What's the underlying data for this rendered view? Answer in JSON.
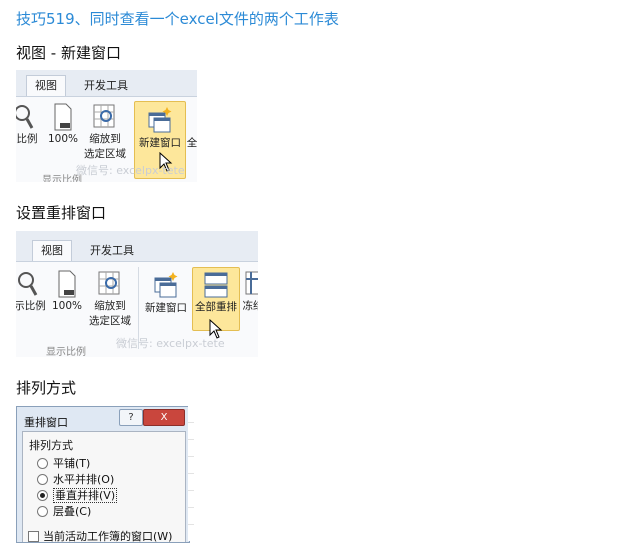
{
  "title": "技巧519、同时查看一个excel文件的两个工作表",
  "sections": {
    "s1": "视图 - 新建窗口",
    "s2": "设置重排窗口",
    "s3": "排列方式"
  },
  "ribbon1": {
    "tabs": [
      "视图",
      "开发工具"
    ],
    "buttons": {
      "zoom": "比例",
      "zoom100": "100%",
      "zoom_sel_1": "缩放到",
      "zoom_sel_2": "选定区域",
      "new_window": "新建窗口",
      "arrange_partial": "全"
    },
    "group_label": "显示比例",
    "watermark": "微信号: excelpx-tete"
  },
  "ribbon2": {
    "tabs": [
      "视图",
      "开发工具"
    ],
    "buttons": {
      "zoom": "示比例",
      "zoom100": "100%",
      "zoom_sel_1": "缩放到",
      "zoom_sel_2": "选定区域",
      "new_window": "新建窗口",
      "arrange_all": "全部重排",
      "freeze_partial": "冻结"
    },
    "group_label": "显示比例",
    "watermark": "微信号: excelpx-tete"
  },
  "dialog": {
    "title": "重排窗口",
    "help": "?",
    "close": "X",
    "fieldset": "排列方式",
    "options": [
      {
        "label": "平铺(T)",
        "selected": false
      },
      {
        "label": "水平并排(O)",
        "selected": false
      },
      {
        "label": "垂直并排(V)",
        "selected": true
      },
      {
        "label": "层叠(C)",
        "selected": false
      }
    ],
    "checkbox": "当前活动工作簿的窗口(W)"
  },
  "colors": {
    "title": "#2b8ad6",
    "highlight": "#fde79b",
    "close": "#c9463d"
  }
}
